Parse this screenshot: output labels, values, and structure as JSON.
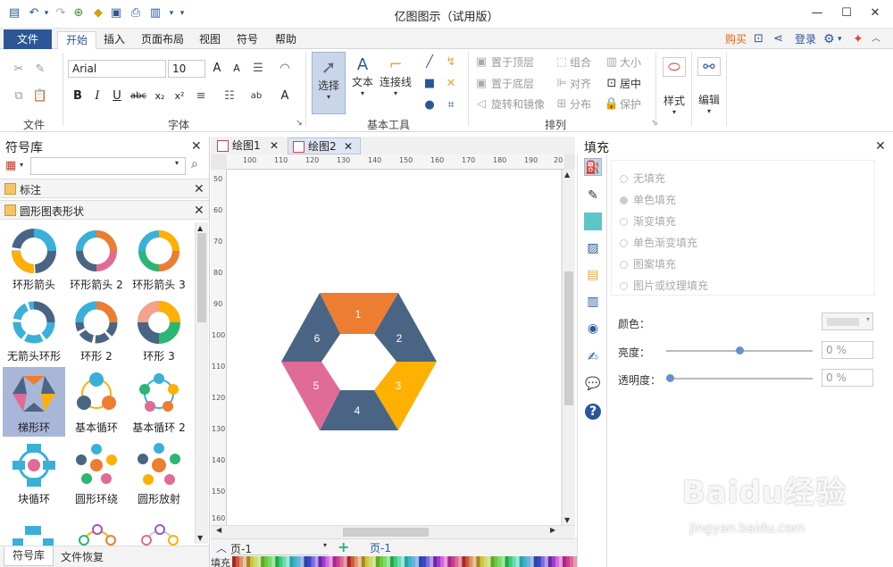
{
  "app_title": "亿图图示（试用版）",
  "menu": {
    "file": "文件",
    "tabs": [
      "开始",
      "插入",
      "页面布局",
      "视图",
      "符号",
      "帮助"
    ],
    "buy": "购买",
    "login": "登录"
  },
  "ribbon": {
    "group_file": "文件",
    "group_font": "字体",
    "group_basic": "基本工具",
    "group_arrange": "排列",
    "font_name": "Arial",
    "font_size": "10",
    "select": "选择",
    "text": "文本",
    "connector": "连接线",
    "bring_front": "置于顶层",
    "send_back": "置于底层",
    "rotate": "旋转和镜像",
    "group": "组合",
    "align": "对齐",
    "distribute": "分布",
    "size": "大小",
    "center": "居中",
    "protect": "保护",
    "style": "样式",
    "edit": "编辑"
  },
  "symbol_library": {
    "title": "符号库",
    "cat_label": "标注",
    "cat_circle": "圆形图表形状",
    "shapes": [
      "环形箭头",
      "环形箭头 2",
      "环形箭头 3",
      "无箭头环形",
      "环形 2",
      "环形 3",
      "梯形环",
      "基本循环",
      "基本循环 2",
      "块循环",
      "圆形环绕",
      "圆形放射"
    ],
    "bottom_tab1": "符号库",
    "bottom_tab2": "文件恢复"
  },
  "doc_tabs": [
    "绘图1",
    "绘图2"
  ],
  "ruler_top": [
    "100",
    "110",
    "120",
    "130",
    "140",
    "150",
    "160",
    "170",
    "180",
    "190",
    "20"
  ],
  "ruler_left": [
    "50",
    "60",
    "70",
    "80",
    "90",
    "100",
    "110",
    "120",
    "130",
    "140",
    "150",
    "160"
  ],
  "hex_labels": [
    "1",
    "2",
    "3",
    "4",
    "5",
    "6"
  ],
  "colors": {
    "seg1": "#ed7d31",
    "seg2": "#4a6584",
    "seg3": "#ffb000",
    "seg4": "#4a6584",
    "seg5": "#e06b96",
    "seg6": "#4a6584",
    "accent": "#2b5797"
  },
  "fill_panel": {
    "title": "填充",
    "options": [
      "无填充",
      "单色填充",
      "渐变填充",
      "单色渐变填充",
      "图案填充",
      "图片或纹理填充"
    ],
    "color_label": "颜色：",
    "brightness_label": "亮度：",
    "brightness_value": "0 %",
    "transparency_label": "透明度：",
    "transparency_value": "0 %"
  },
  "bottom": {
    "page_select": "页-1",
    "page_tab": "页-1",
    "fill_label": "填充"
  },
  "watermark": {
    "brand": "Baidu经验",
    "url": "jingyan.baidu.com"
  }
}
